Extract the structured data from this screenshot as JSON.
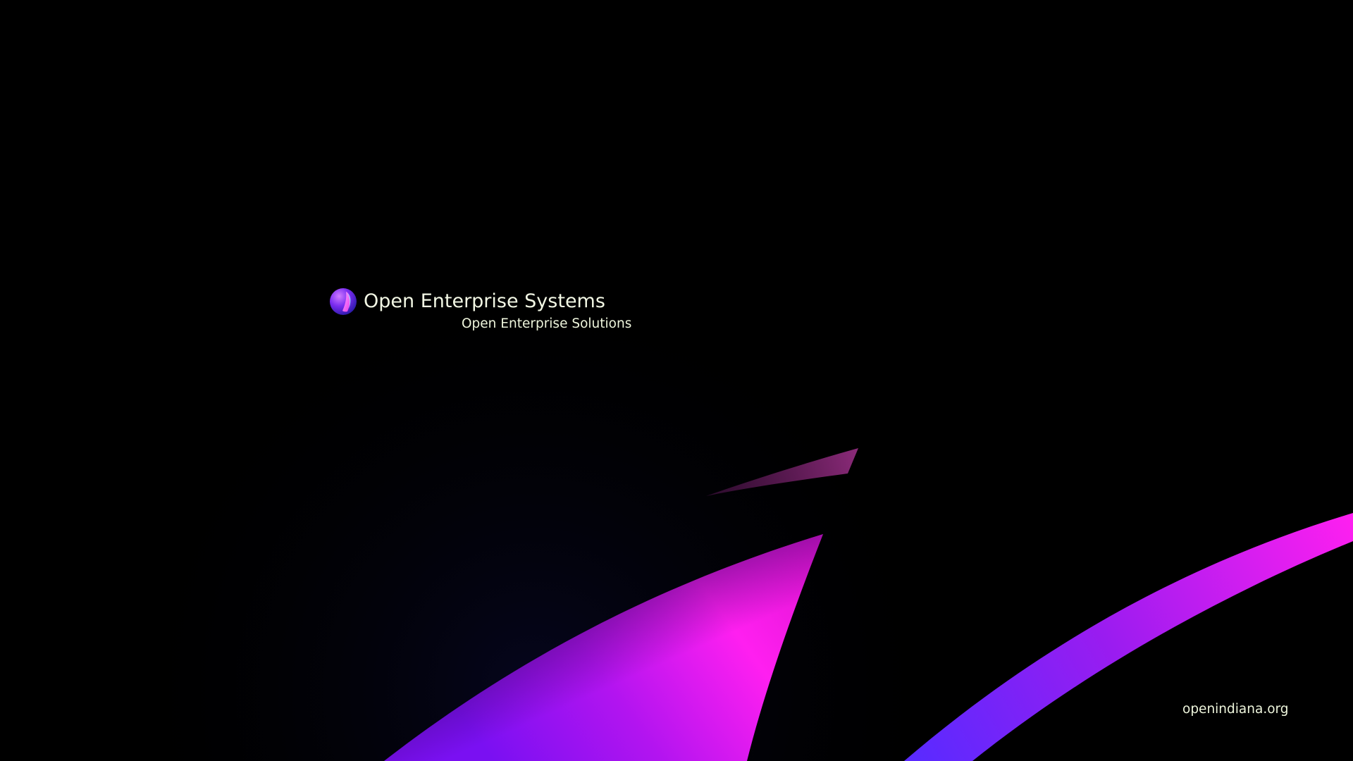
{
  "boot_screen": {
    "title": "Open Enterprise Systems",
    "subtitle": "Open Enterprise Solutions",
    "url": "openindiana.org",
    "logo_icon": "openindiana-globe-icon"
  },
  "colors": {
    "background": "#000000",
    "text": "#eef5dc",
    "magenta": "#ff1ff0",
    "violet": "#8a14f0",
    "blue": "#5a28ff"
  }
}
